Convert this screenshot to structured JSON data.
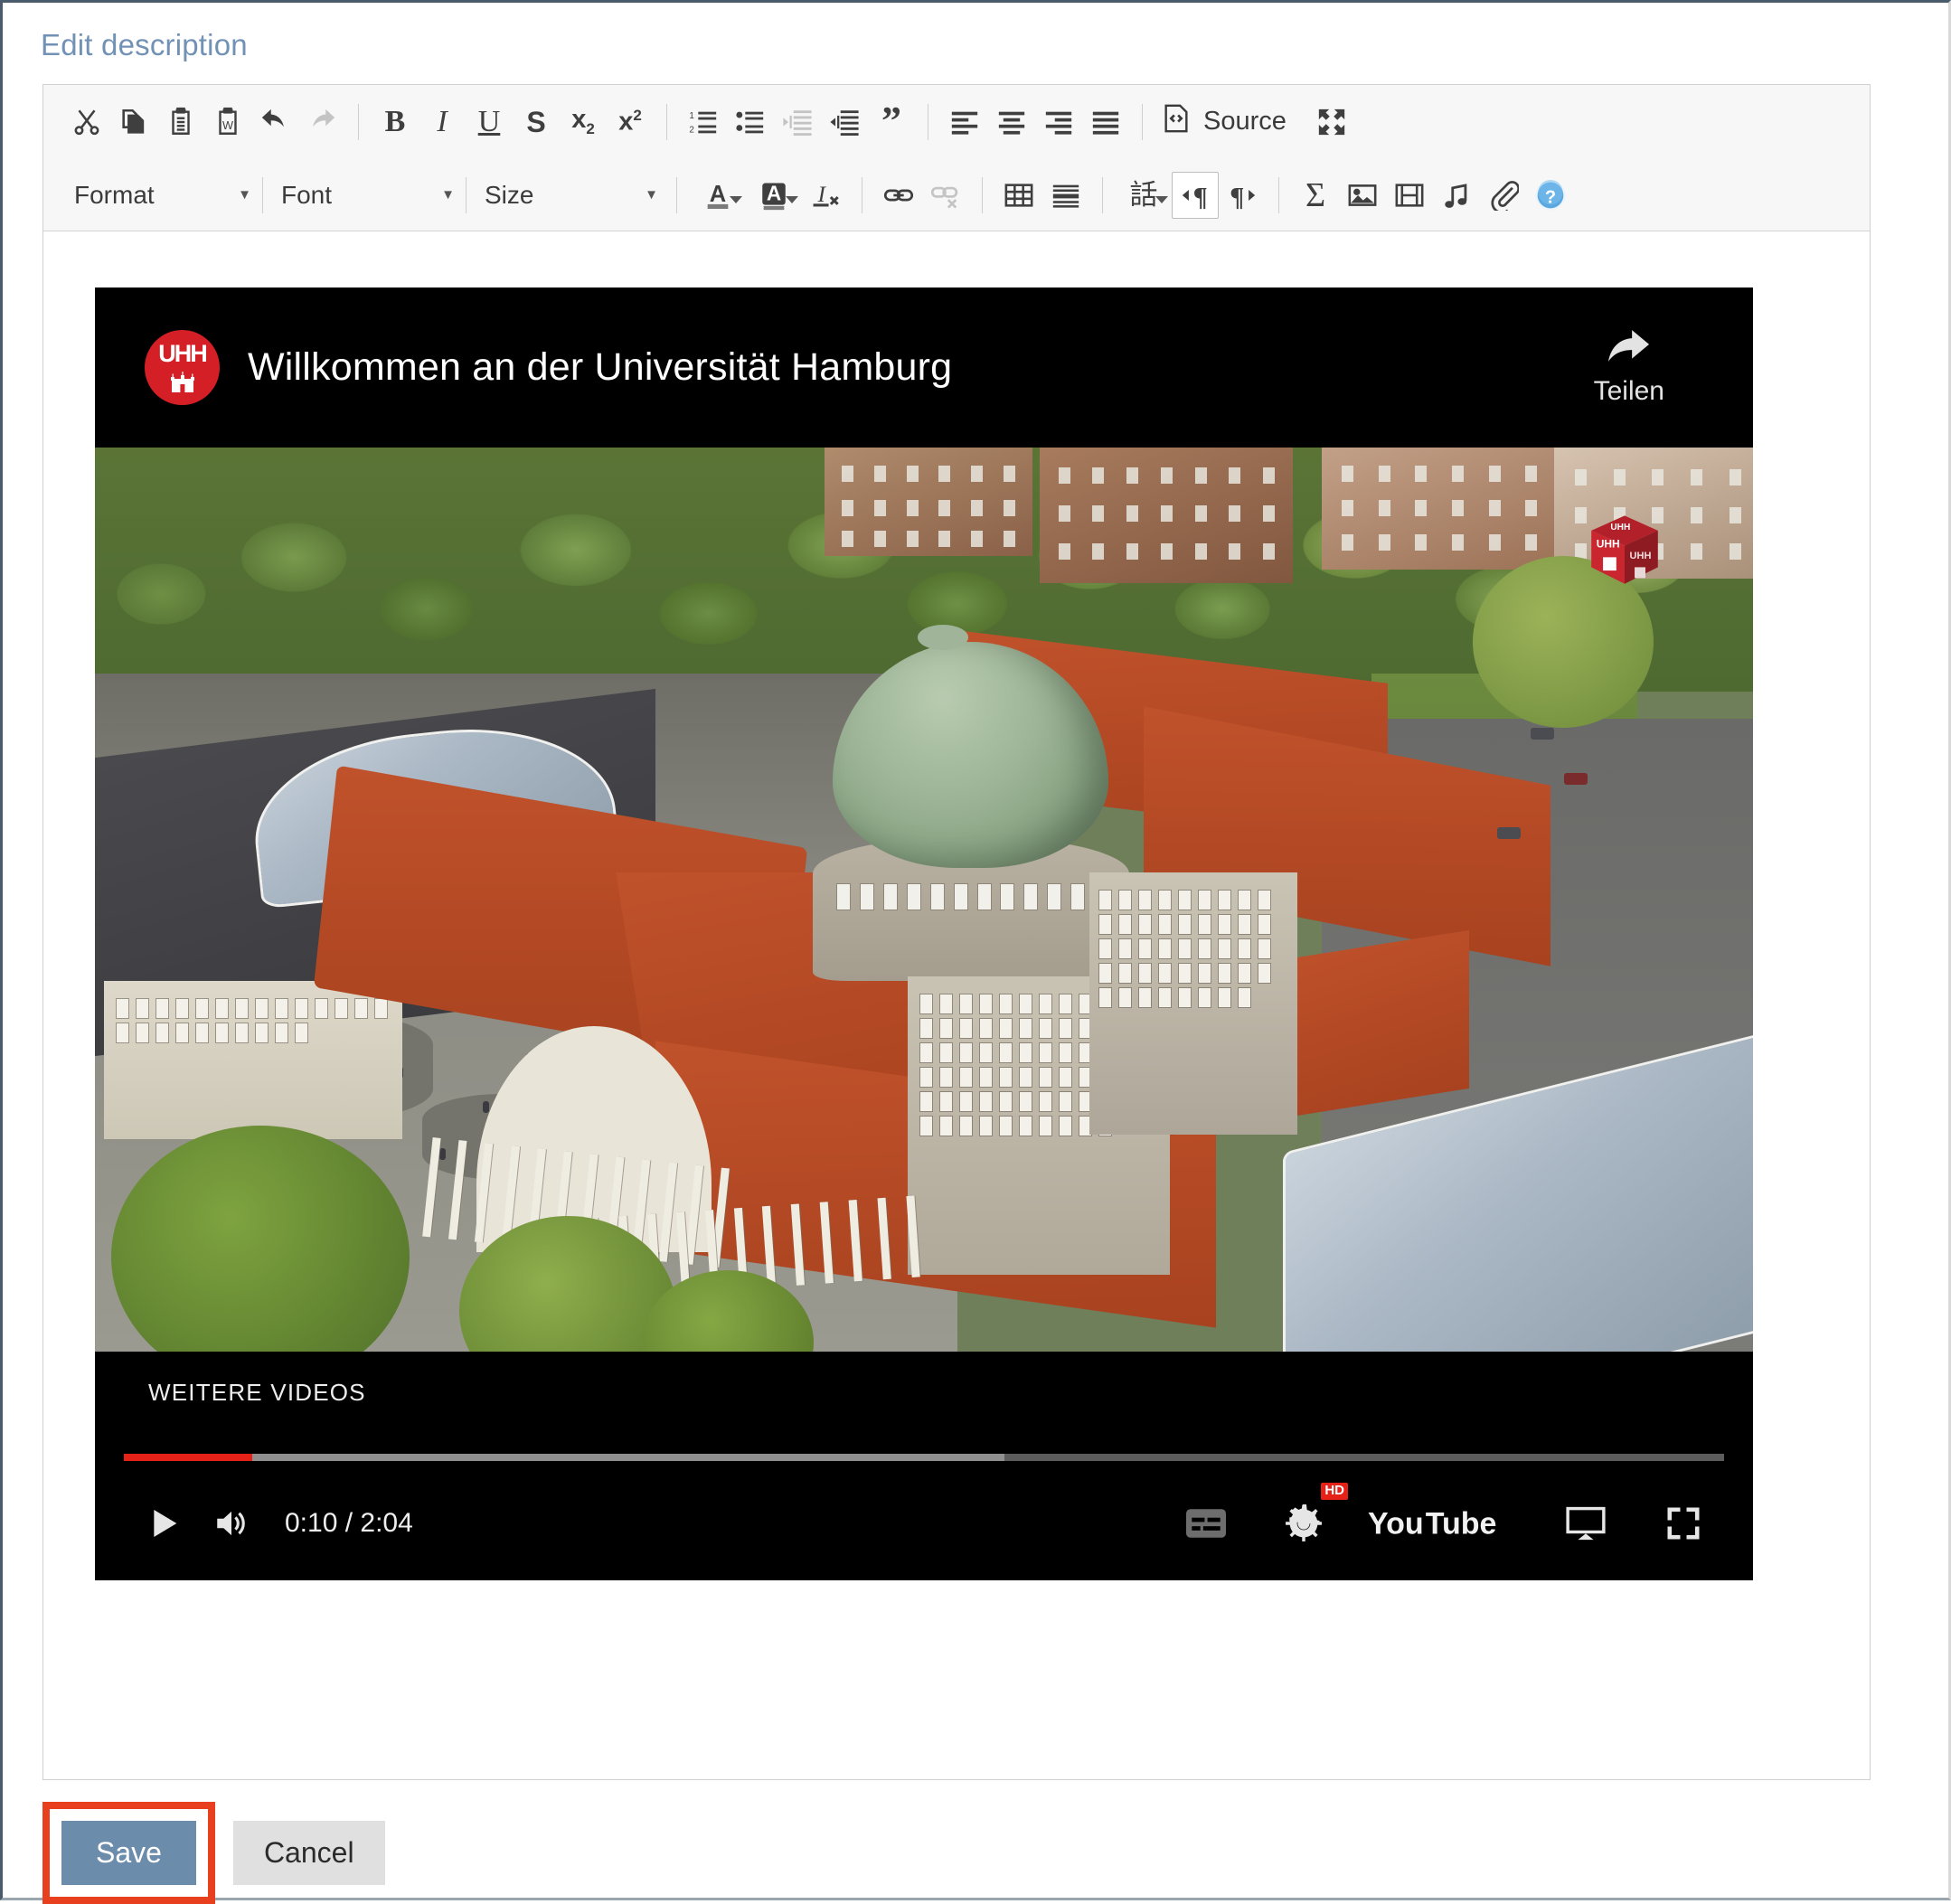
{
  "page": {
    "title": "Edit description"
  },
  "editor": {
    "toolbar_row1": [
      {
        "name": "cut-icon",
        "label": "Cut",
        "disabled": false
      },
      {
        "name": "copy-icon",
        "label": "Copy",
        "disabled": false
      },
      {
        "name": "paste-icon",
        "label": "Paste",
        "disabled": false
      },
      {
        "name": "paste-from-word-icon",
        "label": "Paste from Word",
        "disabled": false
      },
      {
        "name": "undo-icon",
        "label": "Undo",
        "disabled": false
      },
      {
        "name": "redo-icon",
        "label": "Redo",
        "disabled": true
      },
      {
        "name": "bold-icon",
        "label": "Bold",
        "disabled": false
      },
      {
        "name": "italic-icon",
        "label": "Italic",
        "disabled": false
      },
      {
        "name": "underline-icon",
        "label": "Underline",
        "disabled": false
      },
      {
        "name": "strikethrough-icon",
        "label": "Strikethrough",
        "disabled": false
      },
      {
        "name": "subscript-icon",
        "label": "Subscript",
        "disabled": false
      },
      {
        "name": "superscript-icon",
        "label": "Superscript",
        "disabled": false
      },
      {
        "name": "numbered-list-icon",
        "label": "Insert/Remove Numbered List",
        "disabled": false
      },
      {
        "name": "bulleted-list-icon",
        "label": "Insert/Remove Bulleted List",
        "disabled": false
      },
      {
        "name": "decrease-indent-icon",
        "label": "Decrease Indent",
        "disabled": true
      },
      {
        "name": "increase-indent-icon",
        "label": "Increase Indent",
        "disabled": false
      },
      {
        "name": "blockquote-icon",
        "label": "Block Quote",
        "disabled": false
      },
      {
        "name": "align-left-icon",
        "label": "Align Left",
        "disabled": false
      },
      {
        "name": "align-center-icon",
        "label": "Center",
        "disabled": false
      },
      {
        "name": "align-right-icon",
        "label": "Align Right",
        "disabled": false
      },
      {
        "name": "justify-icon",
        "label": "Justify",
        "disabled": false
      }
    ],
    "source_button_label": "Source",
    "source_icon": "source-code-icon",
    "maximize_icon": "maximize-icon",
    "dropdowns": [
      {
        "name": "format-dropdown",
        "label": "Format"
      },
      {
        "name": "font-dropdown",
        "label": "Font"
      },
      {
        "name": "size-dropdown",
        "label": "Size"
      }
    ],
    "toolbar_row2": [
      {
        "name": "text-color-icon",
        "label": "Text Color",
        "disabled": false
      },
      {
        "name": "background-color-icon",
        "label": "Background Color",
        "disabled": false
      },
      {
        "name": "remove-format-icon",
        "label": "Remove Format",
        "disabled": false
      },
      {
        "name": "link-icon",
        "label": "Link",
        "disabled": false
      },
      {
        "name": "unlink-icon",
        "label": "Unlink",
        "disabled": true
      },
      {
        "name": "table-icon",
        "label": "Table",
        "disabled": false
      },
      {
        "name": "horizontal-rule-icon",
        "label": "Horizontal Line",
        "disabled": false
      },
      {
        "name": "language-icon",
        "label": "Language",
        "disabled": false
      },
      {
        "name": "text-direction-ltr-icon",
        "label": "Text direction from left to right",
        "disabled": false
      },
      {
        "name": "text-direction-rtl-icon",
        "label": "Text direction from right to left",
        "disabled": false
      },
      {
        "name": "math-sigma-icon",
        "label": "Mathematical Formula",
        "disabled": false
      },
      {
        "name": "image-icon",
        "label": "Image",
        "disabled": false
      },
      {
        "name": "video-icon",
        "label": "Video",
        "disabled": false
      },
      {
        "name": "audio-icon",
        "label": "Audio",
        "disabled": false
      },
      {
        "name": "attachment-icon",
        "label": "Attachment",
        "disabled": false
      },
      {
        "name": "help-icon",
        "label": "About CKEditor",
        "disabled": false
      }
    ]
  },
  "video": {
    "channel_badge": "UHH",
    "title": "Willkommen an der Universität Hamburg",
    "share_label": "Teilen",
    "share_icon": "share-arrow-icon",
    "more_videos_label": "WEITERE VIDEOS",
    "current_time": "0:10",
    "duration": "2:04",
    "time_display": "0:10 / 2:04",
    "progress_played_percent": 8,
    "progress_loaded_percent": 55,
    "quality_badge": "HD",
    "brand": "YouTube",
    "watermark": "uhh-cube-watermark",
    "controls": [
      {
        "name": "play-button",
        "label": "Play",
        "disabled": false
      },
      {
        "name": "volume-button",
        "label": "Mute",
        "disabled": false
      },
      {
        "name": "subtitles-button",
        "label": "Subtitles",
        "disabled": true
      },
      {
        "name": "settings-button",
        "label": "Settings",
        "disabled": false
      },
      {
        "name": "youtube-logo",
        "label": "YouTube",
        "disabled": false
      },
      {
        "name": "miniplayer-button",
        "label": "Miniplayer",
        "disabled": false
      },
      {
        "name": "fullscreen-button",
        "label": "Full screen",
        "disabled": false
      }
    ]
  },
  "footer": {
    "save_label": "Save",
    "cancel_label": "Cancel"
  },
  "colors": {
    "heading": "#7292b5",
    "save_button": "#6c8cab",
    "cancel_button": "#e0e0e0",
    "annotation_highlight": "#e8401f",
    "uhh_red": "#d51f26",
    "youtube_red": "#e62117"
  }
}
